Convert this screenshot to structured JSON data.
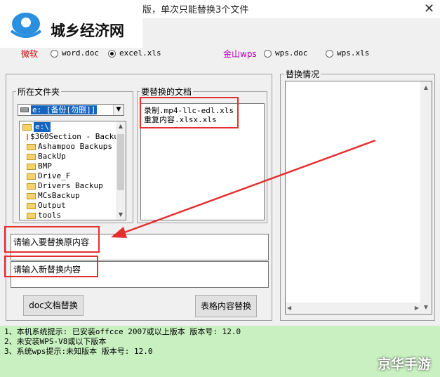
{
  "window": {
    "title": "…版，单次只能替换3个文件",
    "close": "✕"
  },
  "logo": {
    "text": "城乡经济网"
  },
  "options": {
    "ms_label": "微软",
    "word_doc": "word.doc",
    "excel_xls": "excel.xls",
    "wps_label": "金山wps",
    "wps_doc": "wps.doc",
    "wps_xls": "wps.xls",
    "selected": "excel.xls"
  },
  "folder_group": {
    "label": "所在文件夹",
    "drive": "e: [备份[勿删]]",
    "root": "e:\\",
    "folders": [
      "$360Section - Backu",
      "Ashampoo Backups",
      "BackUp",
      "BMP",
      "Drive_F",
      "Drivers Backup",
      "MCsBackup",
      "Output",
      "tools"
    ]
  },
  "docs_group": {
    "label": "要替换的文档",
    "files": [
      "录制.mp4-llc-edl.xls",
      "重复内容.xlsx.xls"
    ]
  },
  "inputs": {
    "find": "请输入要替换原内容",
    "replace": "请输入新替换内容"
  },
  "buttons": {
    "doc_replace": "doc文档替换",
    "table_replace": "表格内容替换"
  },
  "result_group": {
    "label": "替换情况"
  },
  "status": {
    "lines": [
      "1、本机系统提示: 已安装offcce 2007或以上版本 版本号: 12.0",
      "2、未安装WPS-V8或以下版本",
      "3、系统wps提示:未知版本 版本号: 12.0"
    ]
  },
  "watermark": "京华手游",
  "colors": {
    "annotation_red": "#e53030",
    "status_bg": "#c8f0c0"
  }
}
